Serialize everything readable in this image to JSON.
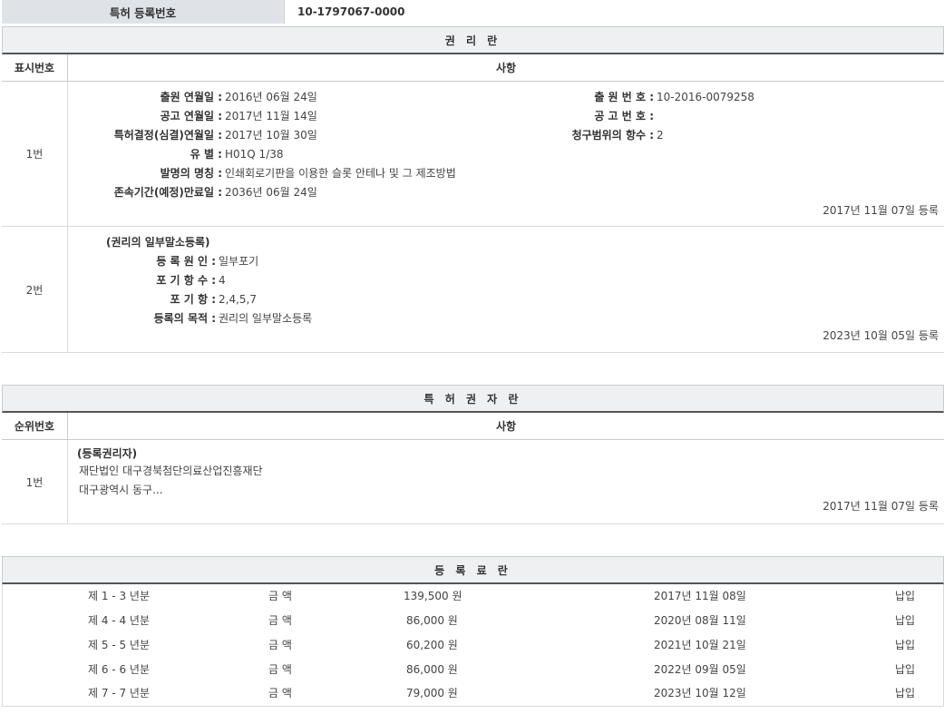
{
  "top": {
    "label": "특허 등록번호",
    "value": "10-1797067-0000"
  },
  "rights": {
    "title": "권 리 란",
    "col_num": "표시번호",
    "col_matter": "사항",
    "row1": {
      "num": "1번",
      "fields": [
        {
          "key": "출원 연월일 :",
          "value": "2016년 06월 24일"
        },
        {
          "key": "공고 연월일 :",
          "value": "2017년 11월 14일"
        },
        {
          "key": "특허결정(심결)연월일 :",
          "value": "2017년 10월 30일"
        },
        {
          "key": "유 별 :",
          "value": "H01Q 1/38"
        },
        {
          "key": "발명의 명칭 :",
          "value": "인쇄회로기판을 이용한 슬롯 안테나 및 그 제조방법"
        },
        {
          "key": "존속기간(예정)만료일 :",
          "value": "2036년 06월 24일"
        }
      ],
      "right_fields": [
        {
          "key": "출 원 번 호 :",
          "value": "10-2016-0079258"
        },
        {
          "key": "공 고 번 호 :",
          "value": ""
        },
        {
          "key": "청구범위의 항수 :",
          "value": "2"
        }
      ],
      "reg_date": "2017년 11월 07일 등록"
    },
    "row2": {
      "num": "2번",
      "heading": "(권리의 일부말소등록)",
      "fields": [
        {
          "key": "등 록 원 인 :",
          "value": "일부포기"
        },
        {
          "key": "포 기 항 수 :",
          "value": "4"
        },
        {
          "key": "포 기 항 :",
          "value": "2,4,5,7"
        },
        {
          "key": "등록의 목적 :",
          "value": "권리의 일부말소등록"
        }
      ],
      "reg_date": "2023년 10월 05일 등록"
    }
  },
  "holder": {
    "title": "특 허 권 자 란",
    "col_num": "순위번호",
    "col_matter": "사항",
    "row1": {
      "num": "1번",
      "heading": "(등록권리자)",
      "line1": "재단법인 대구경북첨단의료산업진흥재단",
      "line2": "대구광역시 동구...",
      "reg_date": "2017년 11월 07일 등록"
    }
  },
  "fees": {
    "title": "등 록 료 란",
    "rows": [
      {
        "period": "제 1 - 3 년분",
        "label": "금 액",
        "amount": "139,500 원",
        "date": "2017년 11월 08일",
        "status": "납입"
      },
      {
        "period": "제 4 - 4 년분",
        "label": "금 액",
        "amount": "86,000 원",
        "date": "2020년 08월 11일",
        "status": "납입"
      },
      {
        "period": "제 5 - 5 년분",
        "label": "금 액",
        "amount": "60,200 원",
        "date": "2021년 10월 21일",
        "status": "납입"
      },
      {
        "period": "제 6 - 6 년분",
        "label": "금 액",
        "amount": "86,000 원",
        "date": "2022년 09월 05일",
        "status": "납입"
      },
      {
        "period": "제 7 - 7 년분",
        "label": "금 액",
        "amount": "79,000 원",
        "date": "2023년 10월 12일",
        "status": "납입"
      }
    ]
  }
}
